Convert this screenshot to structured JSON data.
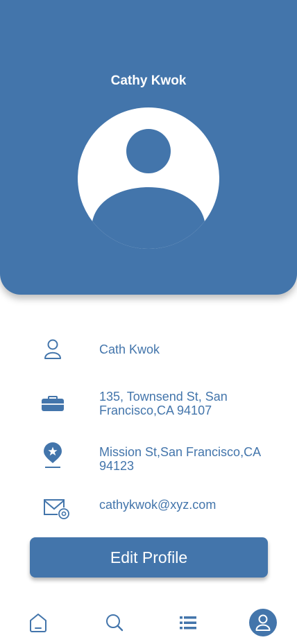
{
  "profile": {
    "name": "Cathy Kwok"
  },
  "details": [
    {
      "icon": "user-icon",
      "text": "Cath Kwok"
    },
    {
      "icon": "briefcase-icon",
      "text": "135, Townsend St, San Francisco,CA 94107"
    },
    {
      "icon": "location-pin-icon",
      "text": "Mission St,San Francisco,CA 94123"
    },
    {
      "icon": "email-icon",
      "text": "cathykwok@xyz.com"
    }
  ],
  "actions": {
    "edit_label": "Edit Profile"
  },
  "nav": [
    {
      "icon": "home-icon",
      "active": false
    },
    {
      "icon": "search-icon",
      "active": false
    },
    {
      "icon": "list-icon",
      "active": false
    },
    {
      "icon": "profile-icon",
      "active": true
    }
  ],
  "colors": {
    "primary": "#4375ab",
    "background": "#ffffff"
  }
}
